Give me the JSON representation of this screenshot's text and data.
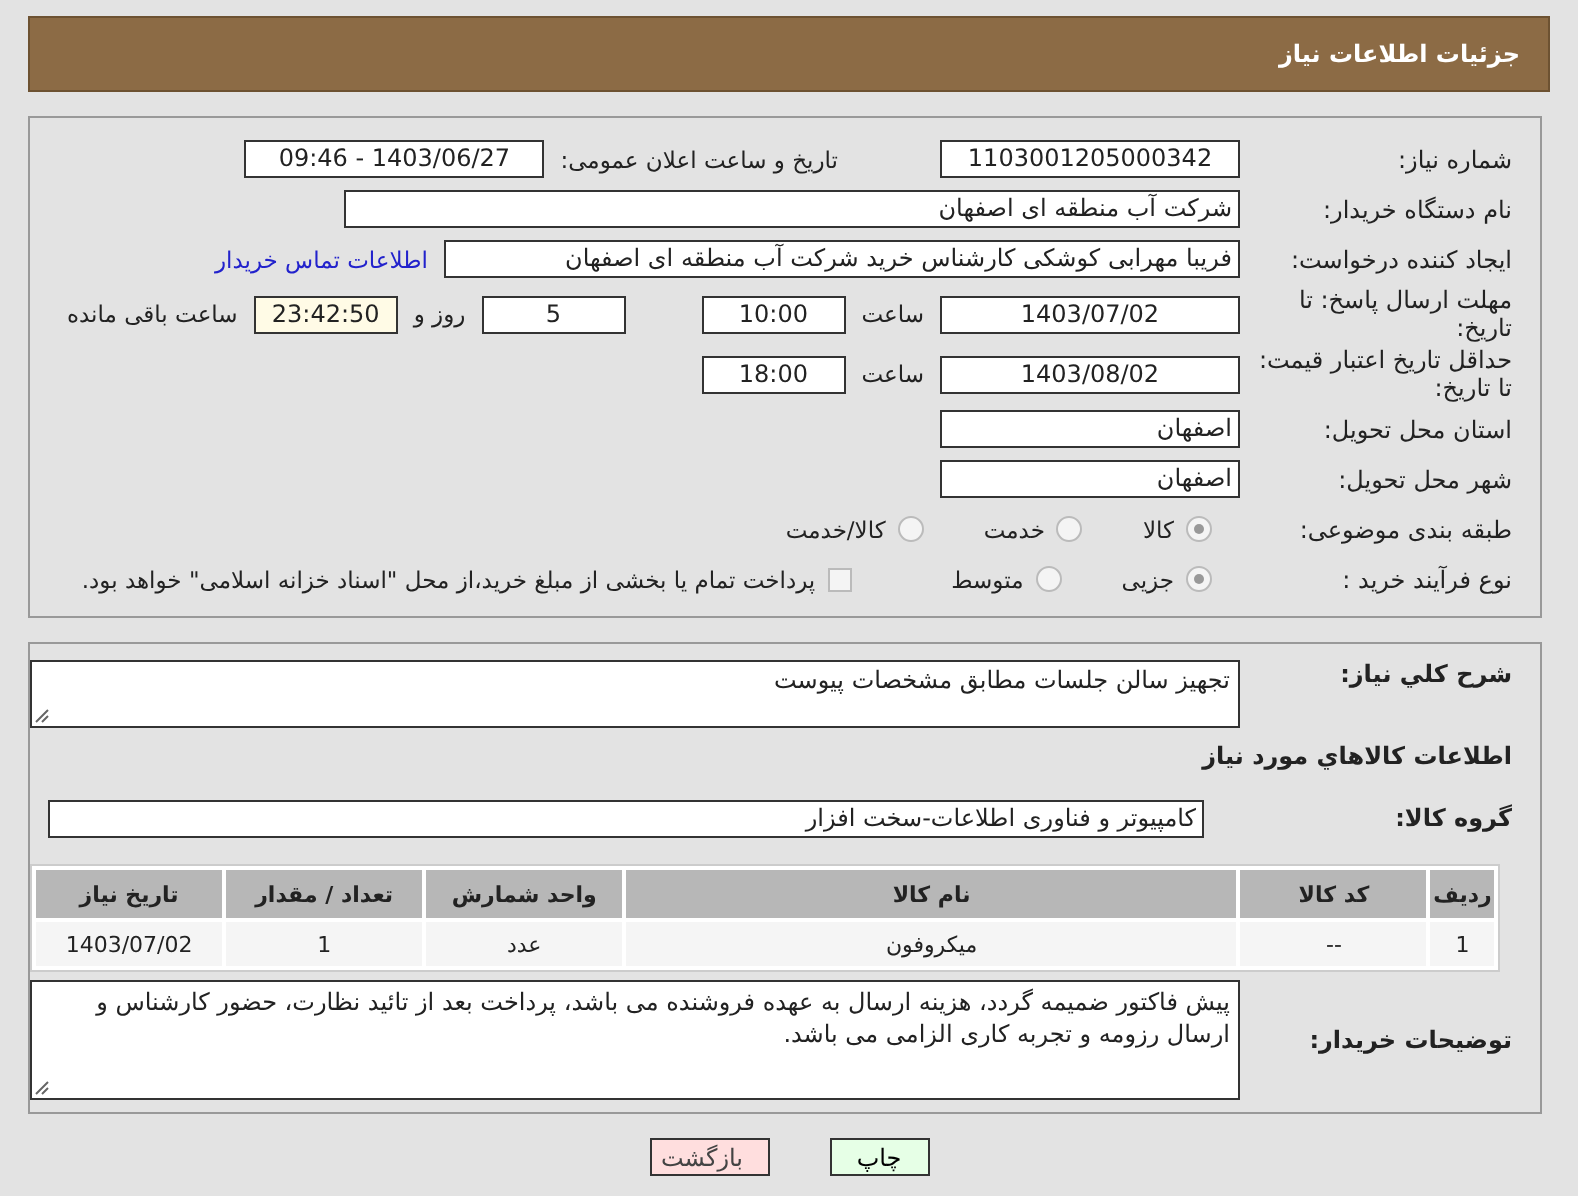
{
  "header": {
    "title": "جزئیات اطلاعات نیاز"
  },
  "need_number": {
    "label": "شماره نیاز:",
    "value": "1103001205000342"
  },
  "announce": {
    "label": "تاریخ و ساعت اعلان عمومی:",
    "value": "1403/06/27 - 09:46"
  },
  "buyer": {
    "label": "نام دستگاه خریدار:",
    "value": "شرکت آب منطقه ای اصفهان"
  },
  "creator": {
    "label": "ایجاد کننده درخواست:",
    "value": "فریبا مهرابی کوشکی کارشناس خرید شرکت آب منطقه ای اصفهان",
    "link": "اطلاعات تماس خریدار"
  },
  "deadline": {
    "label": "مهلت ارسال پاسخ: تا تاریخ:",
    "date": "1403/07/02",
    "time_label": "ساعت",
    "time": "10:00",
    "days": "5",
    "days_label": "روز و",
    "remaining": "23:42:50",
    "remaining_label": "ساعت باقی مانده"
  },
  "validity": {
    "label": "حداقل تاریخ اعتبار قیمت: تا تاریخ:",
    "date": "1403/08/02",
    "time_label": "ساعت",
    "time": "18:00"
  },
  "province": {
    "label": "استان محل تحویل:",
    "value": "اصفهان"
  },
  "city": {
    "label": "شهر محل تحویل:",
    "value": "اصفهان"
  },
  "category": {
    "label": "طبقه بندی موضوعی:",
    "options": [
      {
        "label": "کالا",
        "selected": true
      },
      {
        "label": "خدمت",
        "selected": false
      },
      {
        "label": "کالا/خدمت",
        "selected": false
      }
    ]
  },
  "process": {
    "label": "نوع فرآیند خرید :",
    "options": [
      {
        "label": "جزیی",
        "selected": true
      },
      {
        "label": "متوسط",
        "selected": false
      }
    ],
    "treasury": {
      "label": "پرداخت تمام یا بخشی از مبلغ خرید،از محل \"اسناد خزانه اسلامی\" خواهد بود.",
      "checked": false
    }
  },
  "description": {
    "label": "شرح کلي نیاز:",
    "value": "تجهیز سالن جلسات مطابق مشخصات پیوست"
  },
  "goods_heading": "اطلاعات کالاهاي مورد نیاز",
  "goods_group": {
    "label": "گروه کالا:",
    "value": "کامپیوتر و فناوری اطلاعات-سخت افزار"
  },
  "table": {
    "columns": [
      "ردیف",
      "کد کالا",
      "نام کالا",
      "واحد شمارش",
      "تعداد / مقدار",
      "تاریخ نیاز"
    ],
    "rows": [
      [
        "1",
        "--",
        "میکروفون",
        "عدد",
        "1",
        "1403/07/02"
      ]
    ]
  },
  "notes": {
    "label": "توضیحات خریدار:",
    "value": "پیش فاکتور ضمیمه گردد، هزینه ارسال به عهده فروشنده می باشد، پرداخت بعد از تائید نظارت،  حضور کارشناس و ارسال رزومه و تجربه کاری الزامی می باشد."
  },
  "buttons": [
    {
      "label": "چاپ",
      "kind": "print"
    },
    {
      "label": "بازگشت",
      "kind": "back"
    }
  ]
}
